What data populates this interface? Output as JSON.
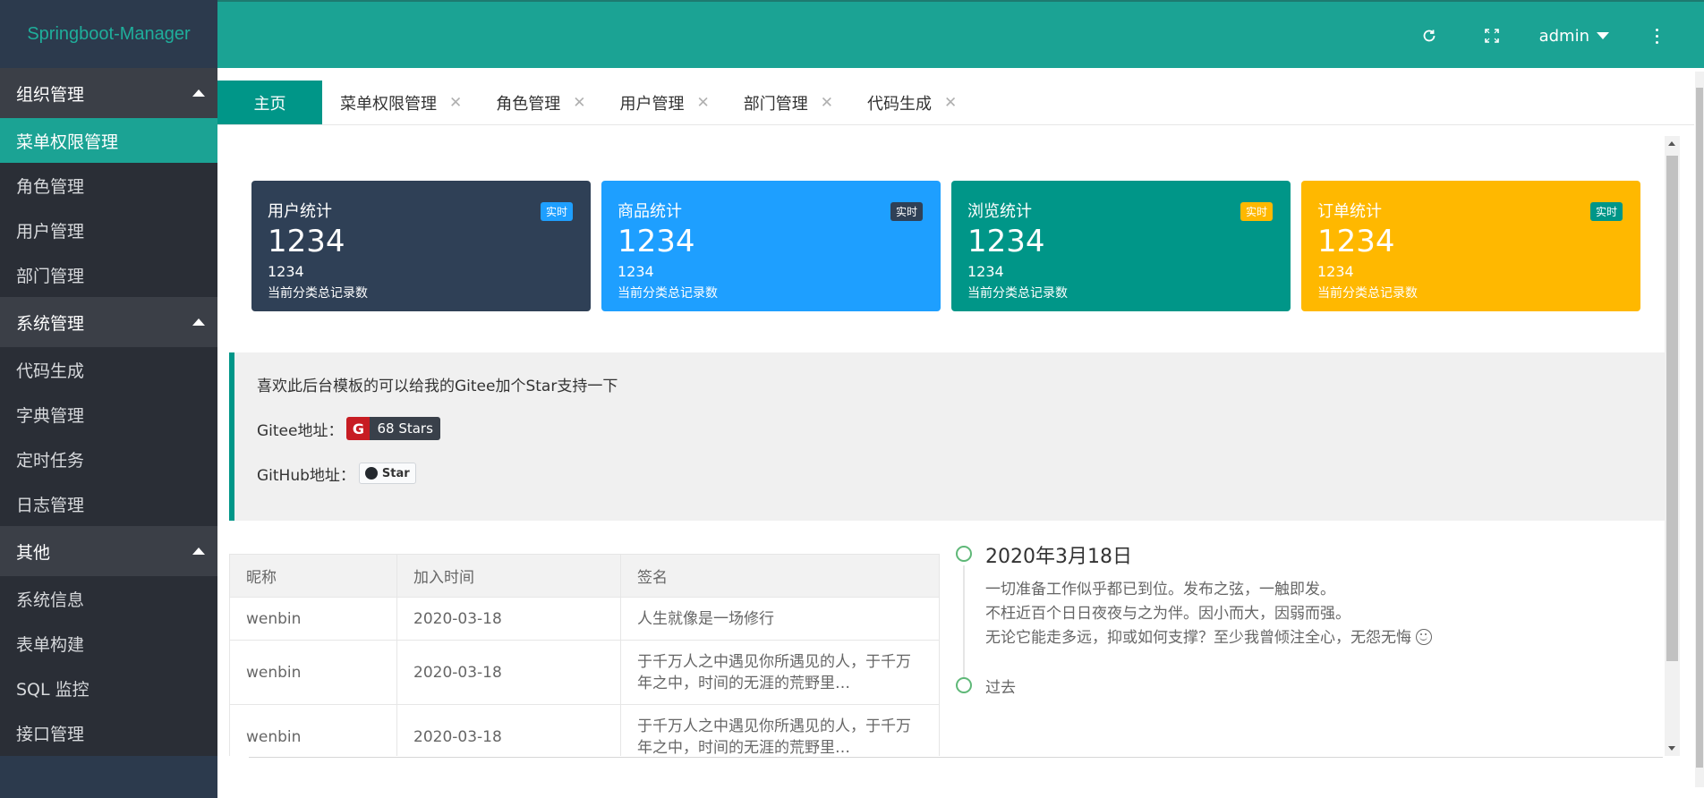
{
  "app": {
    "logo": "Springboot-Manager"
  },
  "sidebar": {
    "groups": [
      {
        "title": "组织管理",
        "items": [
          "菜单权限管理",
          "角色管理",
          "用户管理",
          "部门管理"
        ]
      },
      {
        "title": "系统管理",
        "items": [
          "代码生成",
          "字典管理",
          "定时任务",
          "日志管理"
        ]
      },
      {
        "title": "其他",
        "items": [
          "系统信息",
          "表单构建",
          "SQL 监控",
          "接口管理"
        ]
      }
    ],
    "active_item": "菜单权限管理"
  },
  "header": {
    "user": "admin",
    "icons": [
      "refresh-icon",
      "fullscreen-icon",
      "more-vertical-icon"
    ]
  },
  "tabs": {
    "home": "主页",
    "items": [
      "菜单权限管理",
      "角色管理",
      "用户管理",
      "部门管理",
      "代码生成"
    ],
    "close_glyph": "✕"
  },
  "cards": [
    {
      "title": "用户统计",
      "badge": "实时",
      "value": "1234",
      "sub": "1234",
      "desc": "当前分类总记录数",
      "color": "#2f4056",
      "badge_color": "#1e9fff"
    },
    {
      "title": "商品统计",
      "badge": "实时",
      "value": "1234",
      "sub": "1234",
      "desc": "当前分类总记录数",
      "color": "#1e9fff",
      "badge_color": "#2f4056"
    },
    {
      "title": "浏览统计",
      "badge": "实时",
      "value": "1234",
      "sub": "1234",
      "desc": "当前分类总记录数",
      "color": "#009688",
      "badge_color": "#ffb800"
    },
    {
      "title": "订单统计",
      "badge": "实时",
      "value": "1234",
      "sub": "1234",
      "desc": "当前分类总记录数",
      "color": "#ffb800",
      "badge_color": "#009688"
    }
  ],
  "info": {
    "intro": "喜欢此后台模板的可以给我的Gitee加个Star支持一下",
    "gitee_label": "Gitee地址：",
    "gitee_logo": "G",
    "gitee_stars": "68 Stars",
    "github_label": "GitHub地址：",
    "github_star": "Star"
  },
  "table": {
    "headers": [
      "昵称",
      "加入时间",
      "签名"
    ],
    "rows": [
      [
        "wenbin",
        "2020-03-18",
        "人生就像是一场修行"
      ],
      [
        "wenbin",
        "2020-03-18",
        "于千万人之中遇见你所遇见的人，于千万年之中，时间的无涯的荒野里…"
      ],
      [
        "wenbin",
        "2020-03-18",
        "于千万人之中遇见你所遇见的人，于千万年之中，时间的无涯的荒野里…"
      ]
    ]
  },
  "timeline": {
    "date": "2020年3月18日",
    "lines": [
      "一切准备工作似乎都已到位。发布之弦，一触即发。",
      "不枉近百个日日夜夜与之为伴。因小而大，因弱而强。",
      "无论它能走多远，抑或如何支撑？至少我曾倾注全心，无怨无悔"
    ],
    "past": "过去"
  }
}
